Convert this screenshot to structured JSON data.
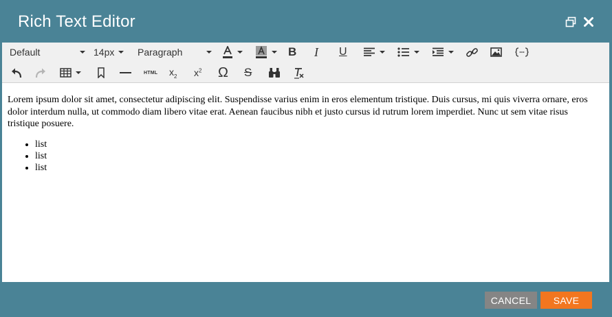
{
  "dialog": {
    "title": "Rich Text Editor"
  },
  "toolbar": {
    "font_family": "Default",
    "font_size": "14px",
    "block_format": "Paragraph",
    "source_code_label": "HTML"
  },
  "content": {
    "paragraph": "Lorem ipsum dolor sit amet, consectetur adipiscing elit. Suspendisse varius enim in eros elementum tristique. Duis cursus, mi quis viverra ornare, eros dolor interdum nulla, ut commodo diam libero vitae erat. Aenean faucibus nibh et justo cursus id rutrum lorem imperdiet. Nunc ut sem vitae risus tristique posuere.",
    "list_items": [
      "list",
      "list",
      "list"
    ]
  },
  "footer": {
    "cancel_label": "CANCEL",
    "save_label": "SAVE"
  },
  "colors": {
    "header_bg": "#4a8396",
    "toolbar_bg": "#f0f0f0",
    "cancel_bg": "#858585",
    "save_bg": "#f2761f"
  }
}
